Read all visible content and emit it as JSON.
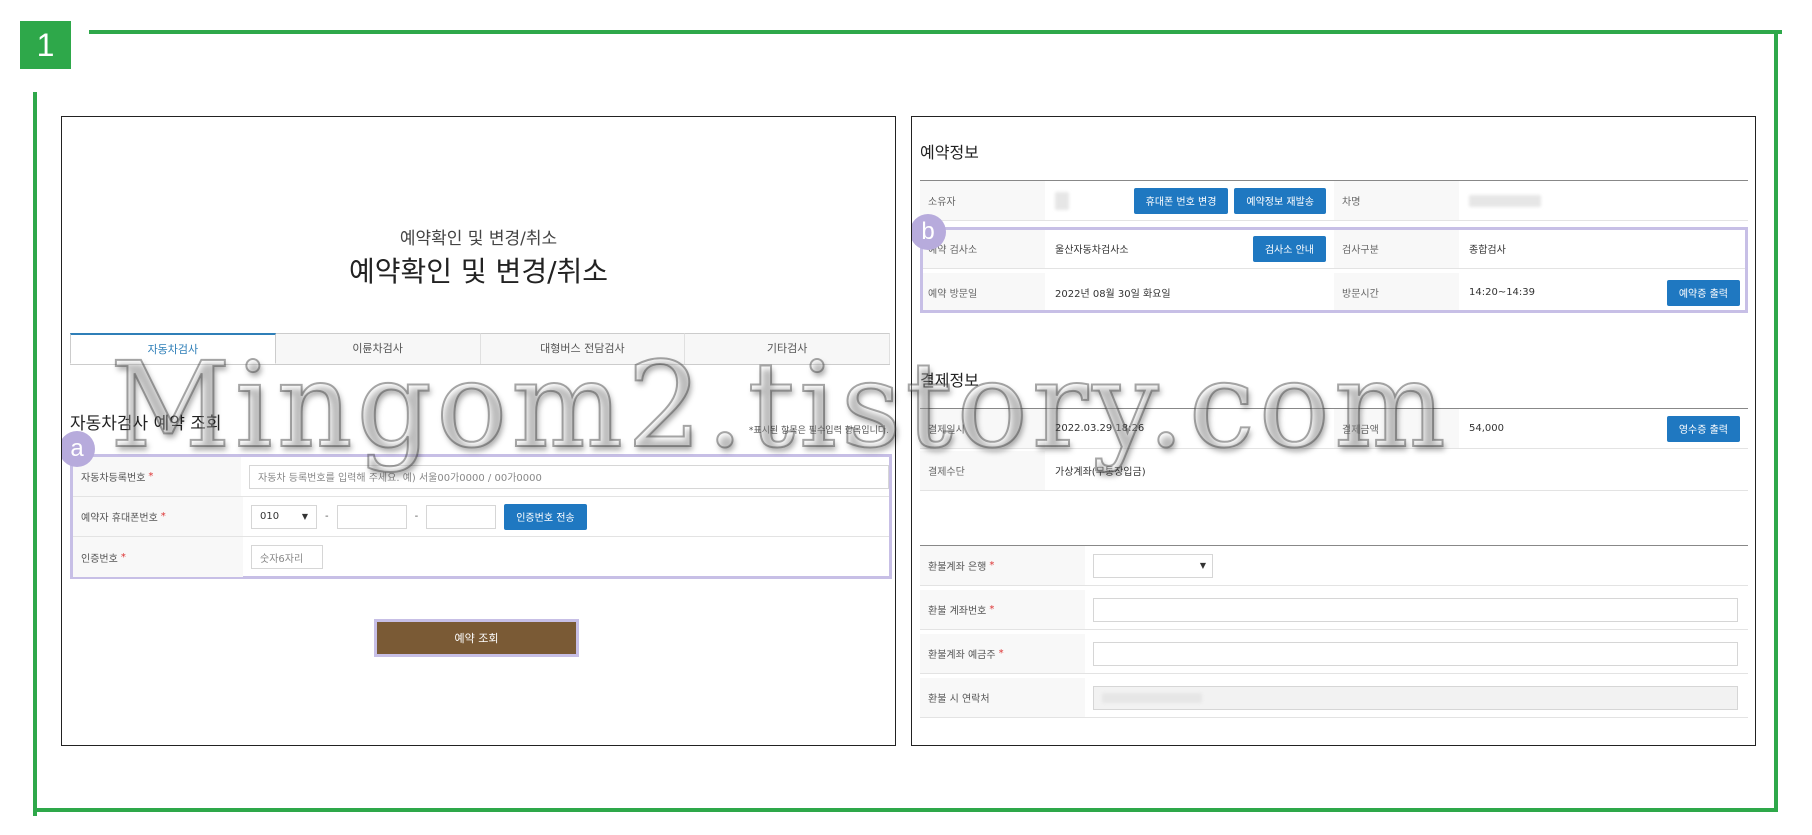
{
  "step_number": "1",
  "left": {
    "subtitle": "예약확인 및 변경/취소",
    "title": "예약확인 및 변경/취소",
    "tabs": [
      "자동차검사",
      "이륜차검사",
      "대형버스 전담검사",
      "기타검사"
    ],
    "section_title": "자동차검사 예약 조회",
    "required_note": "*표시된 항목은 필수입력 항목입니다.",
    "badge": "a",
    "form": {
      "car_number_label": "자동차등록번호",
      "car_number_placeholder": "자동차 등록번호를 입력해 주세요. 예) 서울00가0000 / 00가0000",
      "phone_label": "예약자 휴대폰번호",
      "phone_prefix": "010",
      "phone_dash": "-",
      "send_code_button": "인증번호 전송",
      "auth_label": "인증번호",
      "auth_placeholder": "숫자6자리",
      "required_mark": "*"
    },
    "submit_button": "예약 조회"
  },
  "right": {
    "reservation_title": "예약정보",
    "badge": "b",
    "owner_label": "소유자",
    "change_phone_button": "휴대폰 번호 변경",
    "resend_button": "예약정보 재발송",
    "car_name_label": "차명",
    "center_label": "예약 검사소",
    "center_value": "울산자동차검사소",
    "center_info_button": "검사소 안내",
    "inspection_type_label": "검사구분",
    "inspection_type_value": "종합검사",
    "visit_date_label": "예약 방문일",
    "visit_date_value": "2022년 08월 30일 화요일",
    "visit_time_label": "방문시간",
    "visit_time_value": "14:20~14:39",
    "print_reservation_button": "예약증 출력",
    "payment_title": "결제정보",
    "payment_date_label": "결제일시",
    "payment_date_value": "2022.03.29 18:26",
    "payment_amount_label": "결제금액",
    "payment_amount_value": "54,000",
    "receipt_button": "영수증 출력",
    "payment_method_label": "결제수단",
    "payment_method_value": "가상계좌(무통장입금)",
    "refund_bank_label": "환불계좌 은행",
    "refund_account_label": "환불 계좌번호",
    "refund_holder_label": "환불계좌 예금주",
    "refund_contact_label": "환불 시 연락처",
    "required_mark": "*"
  },
  "watermark": "Mingom2.tistory.com",
  "colors": {
    "frame_green": "#2ea84a",
    "button_blue": "#1f78c1",
    "submit_brown": "#7a5a35",
    "highlight_lavender": "#c7bfe6"
  }
}
